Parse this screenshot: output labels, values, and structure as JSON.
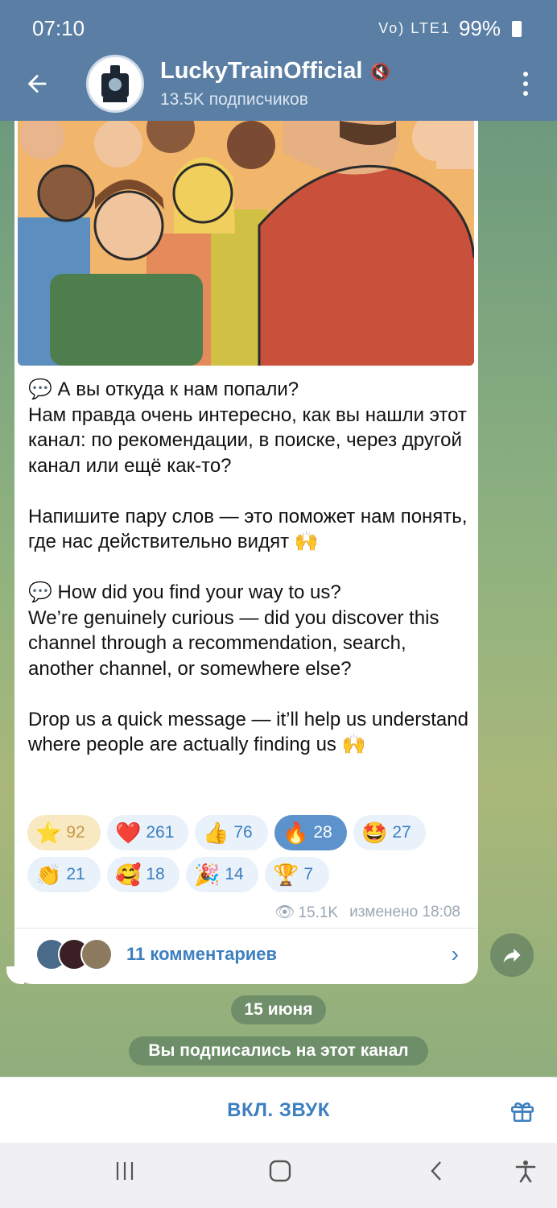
{
  "status_bar": {
    "time": "07:10",
    "signal_text": "Vo) LTE1",
    "battery": "99%"
  },
  "header": {
    "title": "LuckyTrainOfficial",
    "subtitle": "13.5K подписчиков"
  },
  "post": {
    "text": "💬 А вы откуда к нам попали?\nНам правда очень интересно, как вы нашли этот канал: по рекомендации, в поиске, через другой канал или ещё как-то?\n\nНапишите пару слов — это поможет нам понять, где нас действительно видят 🙌\n\n💬 How did you find your way to us?\nWe’re genuinely curious — did you discover this channel through a recommendation, search, another channel, or somewhere else?\n\nDrop us a quick message — it’ll help us understand where people are actually finding us 🙌",
    "reactions": [
      {
        "emoji": "⭐",
        "count": "92"
      },
      {
        "emoji": "❤️",
        "count": "261"
      },
      {
        "emoji": "👍",
        "count": "76"
      },
      {
        "emoji": "🔥",
        "count": "28"
      },
      {
        "emoji": "🤩",
        "count": "27"
      },
      {
        "emoji": "👏",
        "count": "21"
      },
      {
        "emoji": "🥰",
        "count": "18"
      },
      {
        "emoji": "🎉",
        "count": "14"
      },
      {
        "emoji": "🏆",
        "count": "7"
      }
    ],
    "views": "15.1K",
    "edited_time": "изменено 18:08",
    "comments_label": "11 комментариев"
  },
  "date_label": "15 июня",
  "system_message": "Вы подписались на этот канал",
  "bottom": {
    "unmute_label": "ВКЛ. ЗВУК"
  },
  "colors": {
    "header": "#5a7ea4",
    "accent": "#3d7fbf",
    "selected_reaction": "#5d93cc"
  }
}
